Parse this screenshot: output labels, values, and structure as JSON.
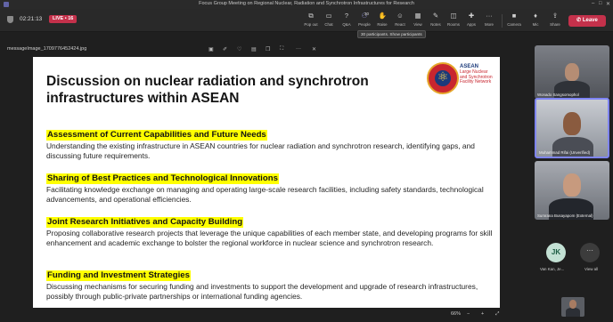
{
  "window": {
    "title": "Focus Group Meeting on Regional Nuclear, Radiation and Synchrotron Infrastructures for Research"
  },
  "meeting": {
    "timer": "02:21:13",
    "live_label": "LIVE",
    "live_count": "16",
    "leave_label": "Leave",
    "tooltip": "30 participants. Show participants",
    "toolbar": [
      {
        "label": "Pop out",
        "icon": "pop-out-icon"
      },
      {
        "label": "Chat",
        "icon": "chat-icon"
      },
      {
        "label": "Q&A",
        "icon": "qa-icon"
      },
      {
        "label": "People",
        "icon": "people-icon",
        "count": "30"
      },
      {
        "label": "Raise",
        "icon": "raise-hand-icon"
      },
      {
        "label": "React",
        "icon": "react-icon"
      },
      {
        "label": "View",
        "icon": "view-icon"
      },
      {
        "label": "Notes",
        "icon": "notes-icon"
      },
      {
        "label": "Rooms",
        "icon": "rooms-icon"
      },
      {
        "label": "Apps",
        "icon": "apps-icon"
      },
      {
        "label": "More",
        "icon": "more-icon"
      },
      {
        "label": "Camera",
        "icon": "camera-icon"
      },
      {
        "label": "Mic",
        "icon": "mic-icon"
      },
      {
        "label": "Share",
        "icon": "share-icon"
      }
    ]
  },
  "share": {
    "filename": "messageImage_1709776452424.jpg",
    "zoom": "66%"
  },
  "slide": {
    "title": "Discussion on nuclear radiation and synchrotron infrastructures within ASEAN",
    "logo_text_1": "ASEAN",
    "logo_text_2": "Large Nuclear and Synchrotron Facility Network",
    "sections": [
      {
        "heading": "Assessment of Current Capabilities and Future Needs",
        "body": "Understanding the existing infrastructure in ASEAN countries for nuclear radiation and synchrotron research, identifying gaps, and discussing future requirements."
      },
      {
        "heading": "Sharing of Best Practices and Technological Innovations",
        "body": "Facilitating knowledge exchange on managing and operating large-scale research facilities, including safety standards, technological advancements, and operational efficiencies."
      },
      {
        "heading": "Joint Research Initiatives and Capacity Building",
        "body": "Proposing collaborative research projects that leverage the unique capabilities of each member state, and developing programs for skill enhancement and academic exchange to bolster the regional workforce in nuclear science and synchrotron research."
      },
      {
        "heading": "Funding and Investment Strategies",
        "body": "Discussing mechanisms for securing funding and investments to support the development and upgrade of research infrastructures, possibly through public-private partnerships or international funding agencies."
      }
    ]
  },
  "participants": [
    {
      "name": "Wonado Sangsomophol"
    },
    {
      "name": "Muhammad Rifai (Unverified)"
    },
    {
      "name": "Sumrana Busayapom (External)"
    }
  ],
  "avatar_jk": {
    "initials": "JK",
    "name": "Van Kan, Je..."
  },
  "view_all": {
    "label": "View all"
  }
}
